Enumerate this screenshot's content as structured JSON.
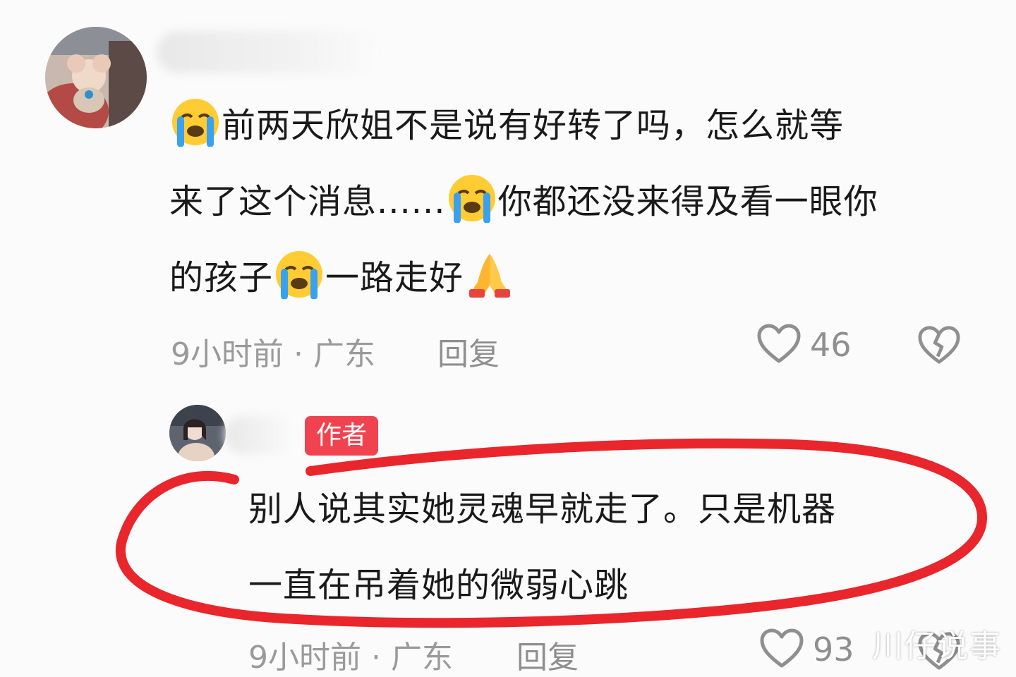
{
  "comments": [
    {
      "lines": [
        [
          "前两天欣姐不是说有好转了吗，怎么就等"
        ],
        [
          "来了这个消息......",
          "你都还没来得及看一眼你"
        ],
        [
          "的孩子",
          "一路走好"
        ]
      ],
      "emoji_names": [
        "loudly-crying-face",
        "folded-hands"
      ],
      "time_location": "9小时前 · 广东",
      "reply_label": "回复",
      "like_count": "46"
    },
    {
      "author_badge": "作者",
      "lines": [
        [
          "别人说其实她灵魂早就走了。只是机器"
        ],
        [
          "一直在吊着她的微弱心跳"
        ]
      ],
      "time_location": "9小时前 · 广东",
      "reply_label": "回复",
      "like_count": "93"
    }
  ],
  "watermark": "川仔说事",
  "colors": {
    "badge": "#f0434f",
    "highlight_ring": "#e8262b",
    "meta_text": "#9a9a9a"
  }
}
